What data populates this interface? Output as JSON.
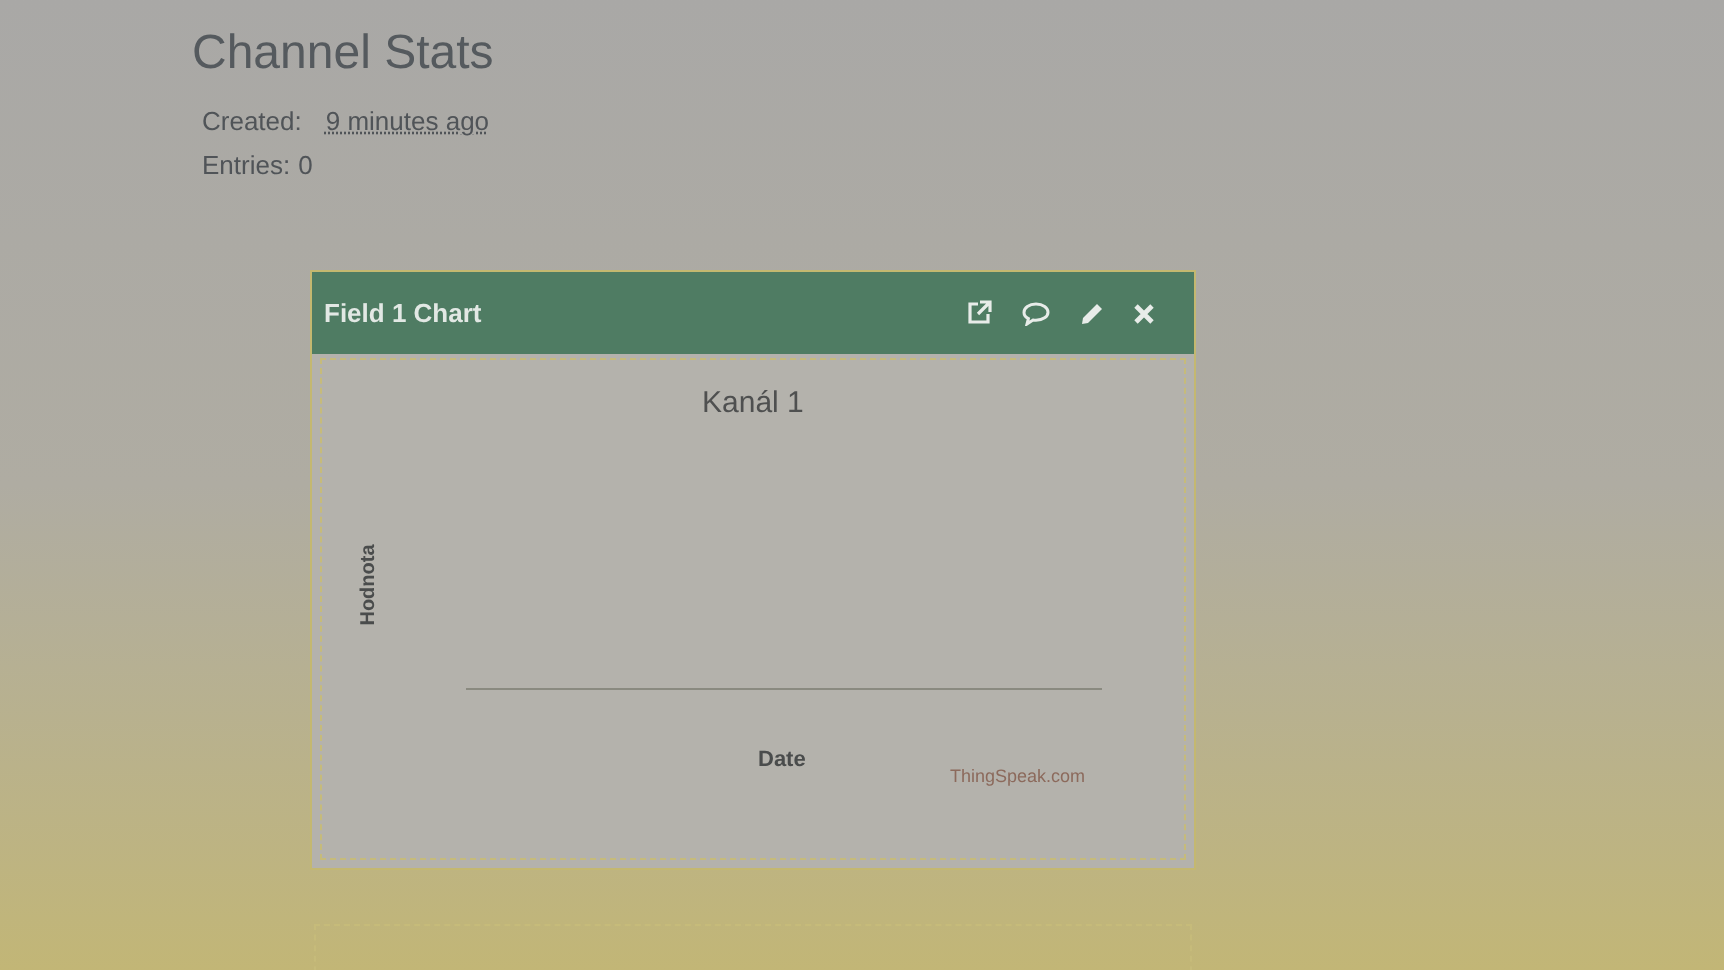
{
  "page_title": "Channel Stats",
  "stats": [
    {
      "label": "Created:",
      "value": "9 minutes ago"
    },
    {
      "label": "Entries:",
      "value": "0"
    }
  ],
  "chart_card": {
    "title": "Field 1 Chart",
    "actions": [
      {
        "kind": "open"
      },
      {
        "kind": "comment"
      },
      {
        "kind": "edit"
      },
      {
        "kind": "close"
      }
    ],
    "chart": {
      "title": "Kanál 1",
      "ylabel": "Hodnota",
      "xlabel": "Date",
      "credit": "ThingSpeak.com"
    }
  }
}
